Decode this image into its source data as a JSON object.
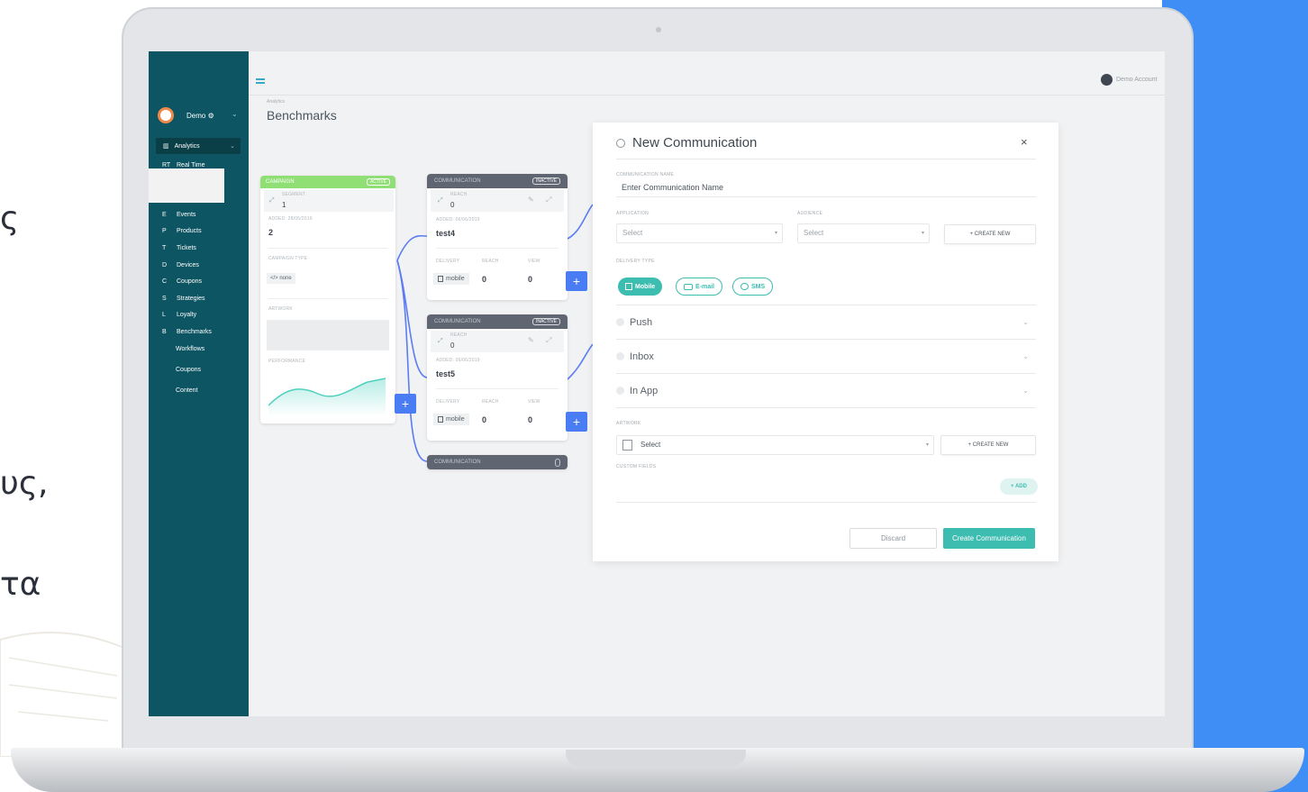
{
  "page_fragments": [
    "ς",
    "υς,",
    "τα"
  ],
  "sidebar": {
    "brand": "Demo ⚙",
    "active_item": "Analytics",
    "realtime": {
      "letter": "RT",
      "label": "Real Time"
    },
    "items": [
      {
        "letter": "E",
        "label": "Events"
      },
      {
        "letter": "P",
        "label": "Products"
      },
      {
        "letter": "T",
        "label": "Tickets"
      },
      {
        "letter": "D",
        "label": "Devices"
      },
      {
        "letter": "C",
        "label": "Coupons"
      },
      {
        "letter": "S",
        "label": "Strategies"
      },
      {
        "letter": "L",
        "label": "Loyalty"
      },
      {
        "letter": "B",
        "label": "Benchmarks"
      }
    ],
    "sub_items": [
      "Workflows",
      "Coupons",
      "Content"
    ]
  },
  "header": {
    "account_label": "Demo Account",
    "breadcrumb": "Analytics",
    "title": "Benchmarks"
  },
  "campaign_card": {
    "header": "CAMPAIGN",
    "status": "ACTIVE",
    "segment_label": "SEGMENT",
    "segment_value": "1",
    "added_label": "ADDED: 28/05/2019",
    "added_value": "2",
    "type_label": "CAMPAIGN TYPE",
    "type_value": "</> none",
    "artwork_label": "ARTWORK",
    "performance_label": "PERFORMANCE"
  },
  "communication_cards": [
    {
      "header": "COMMUNICATION",
      "status": "INACTIVE",
      "reach_label": "REACH",
      "reach_top": "0",
      "added_label": "ADDED: 06/06/2019",
      "name": "test4",
      "delivery_label": "DELIVERY",
      "reach_col_label": "REACH",
      "view_label": "VIEW",
      "delivery_value": "mobile",
      "reach_value": "0",
      "view_value": "0"
    },
    {
      "header": "COMMUNICATION",
      "status": "INACTIVE",
      "reach_label": "REACH",
      "reach_top": "0",
      "added_label": "ADDED: 06/06/2019",
      "name": "test5",
      "delivery_label": "DELIVERY",
      "reach_col_label": "REACH",
      "view_label": "VIEW",
      "delivery_value": "mobile",
      "reach_value": "0",
      "view_value": "0"
    }
  ],
  "collapsed_card": {
    "header": "COMMUNICATION"
  },
  "plus_label": "+",
  "modal": {
    "title": "New Communication",
    "close": "×",
    "name_label": "COMMUNICATION NAME",
    "name_placeholder": "Enter Communication Name",
    "application_label": "APPLICATION",
    "application_value": "Select",
    "audience_label": "AUDIENCE",
    "audience_value": "Select",
    "create_new_label": "+ CREATE NEW",
    "delivery_type_label": "DELIVERY TYPE",
    "delivery_types": [
      "Mobile",
      "E-mail",
      "SMS"
    ],
    "sections": [
      "Push",
      "Inbox",
      "In App"
    ],
    "artwork_label": "ARTWORK",
    "artwork_value": "Select",
    "artwork_create_label": "+ CREATE NEW",
    "custom_fields_label": "CUSTOM FIELDS",
    "add_label": "+ ADD",
    "discard_label": "Discard",
    "submit_label": "Create Communication"
  },
  "colors": {
    "sidebar": "#0d5562",
    "accent": "#3dbdb0",
    "plus_button": "#4a7cf4",
    "active_header": "#8fdf75",
    "panel": "#3f8ef5"
  }
}
